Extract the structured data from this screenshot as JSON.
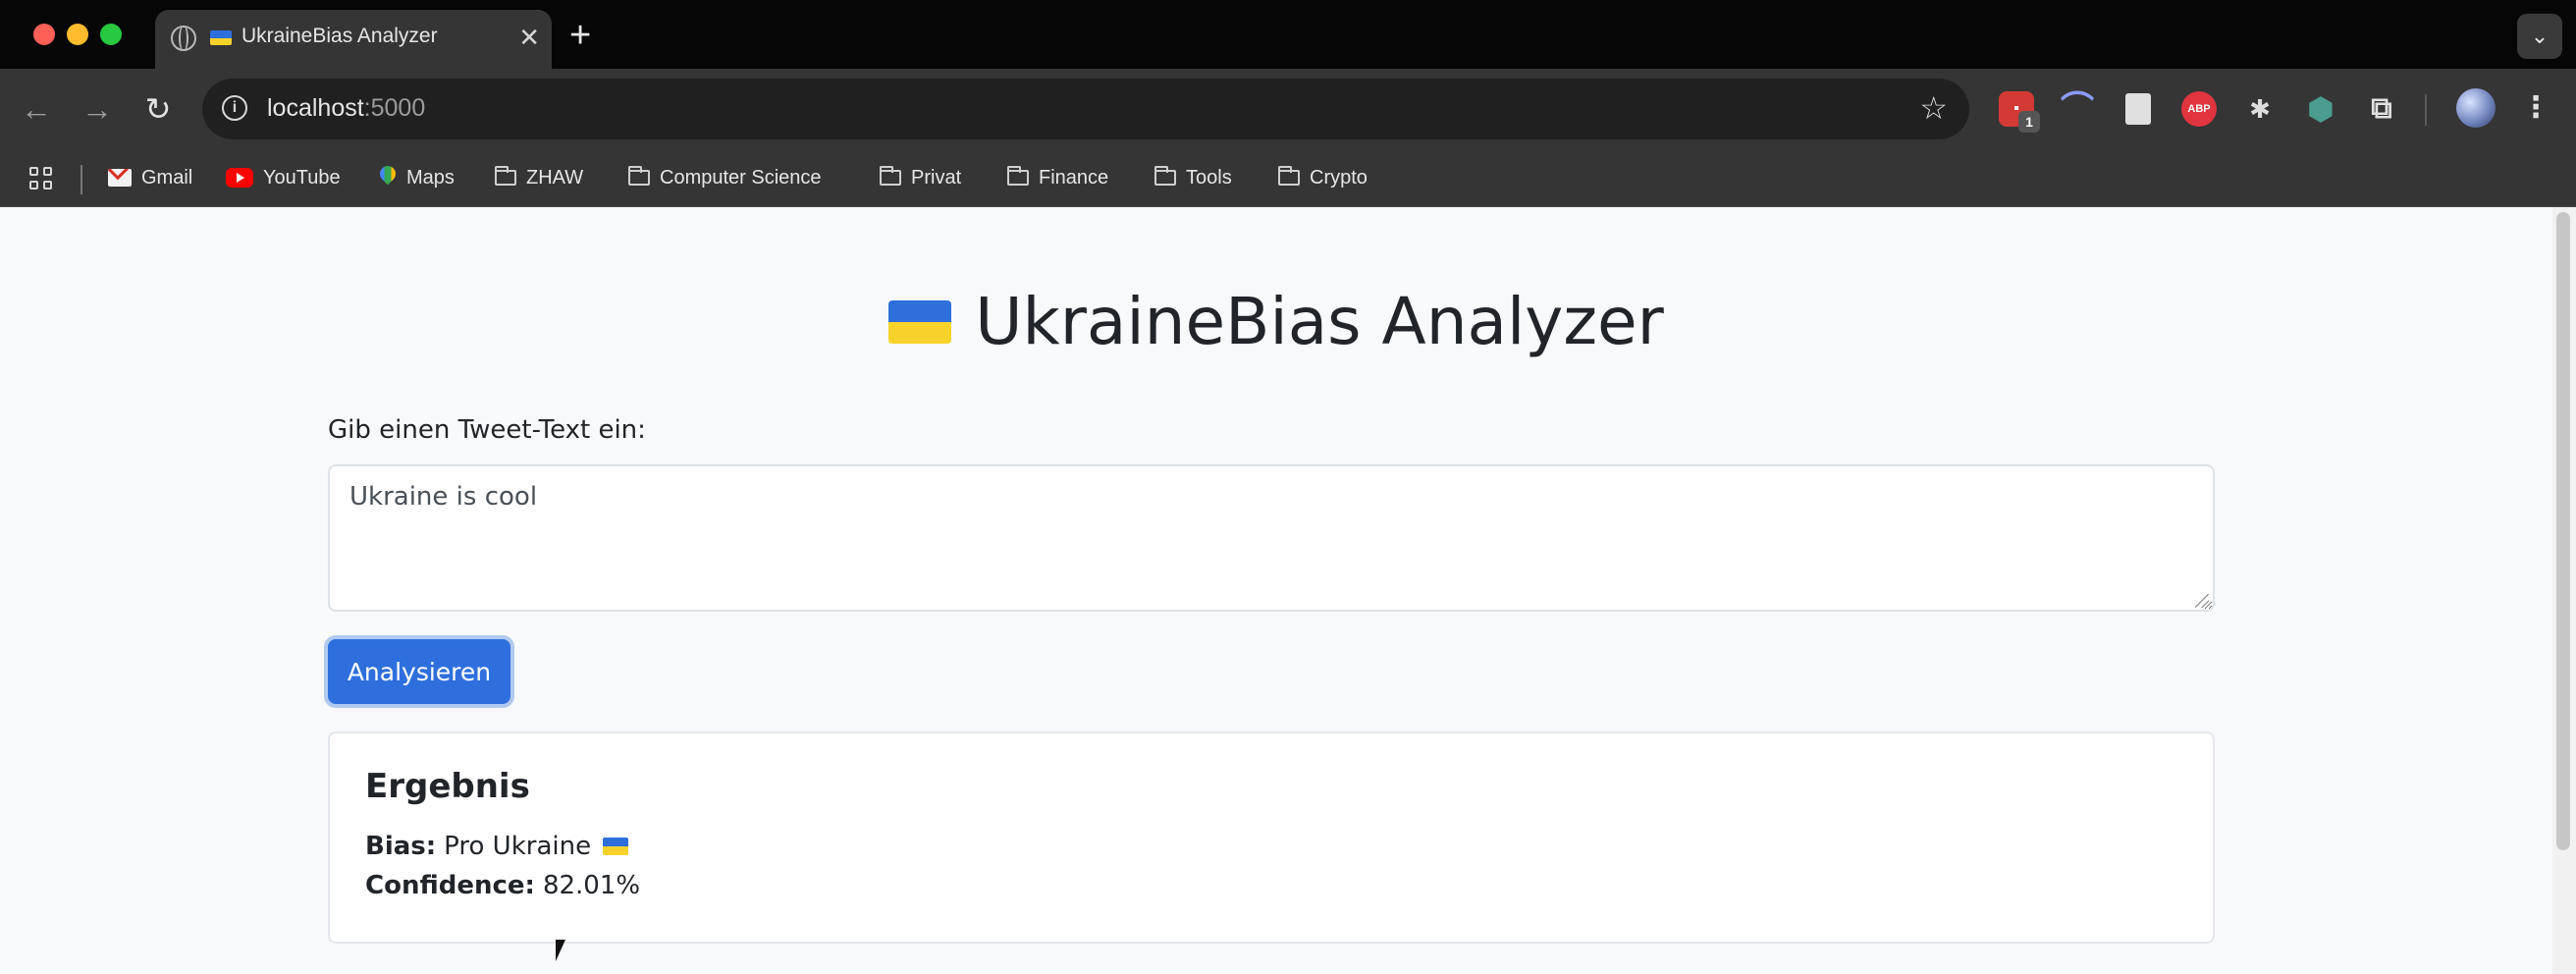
{
  "browser": {
    "tab": {
      "title": "UkraineBias Analyzer"
    },
    "new_tab_symbol": "+",
    "tab_close_symbol": "✕",
    "address": {
      "host": "localhost",
      "port": ":5000"
    },
    "extensions": {
      "ext1_badge": "1",
      "ext4_label": "ABP"
    },
    "bookmarks": [
      {
        "label": "Gmail",
        "icon": "gmail-icon"
      },
      {
        "label": "YouTube",
        "icon": "youtube-icon"
      },
      {
        "label": "Maps",
        "icon": "maps-icon"
      },
      {
        "label": "ZHAW",
        "icon": "folder-icon"
      },
      {
        "label": "Computer Science",
        "icon": "folder-icon"
      },
      {
        "label": "Privat",
        "icon": "folder-icon"
      },
      {
        "label": "Finance",
        "icon": "folder-icon"
      },
      {
        "label": "Tools",
        "icon": "folder-icon"
      },
      {
        "label": "Crypto",
        "icon": "folder-icon"
      }
    ]
  },
  "page": {
    "title": "UkraineBias Analyzer",
    "input_label": "Gib einen Tweet-Text ein:",
    "input_value": "Ukraine is cool",
    "analyze_button": "Analysieren",
    "result": {
      "heading": "Ergebnis",
      "bias_label": "Bias:",
      "bias_value": "Pro Ukraine",
      "confidence_label": "Confidence:",
      "confidence_value": "82.01%"
    }
  },
  "colors": {
    "flag_blue": "#2f6fdc",
    "flag_yellow": "#f7d22b",
    "button_primary": "#2e6fdd",
    "page_background": "#f8f9fa"
  }
}
